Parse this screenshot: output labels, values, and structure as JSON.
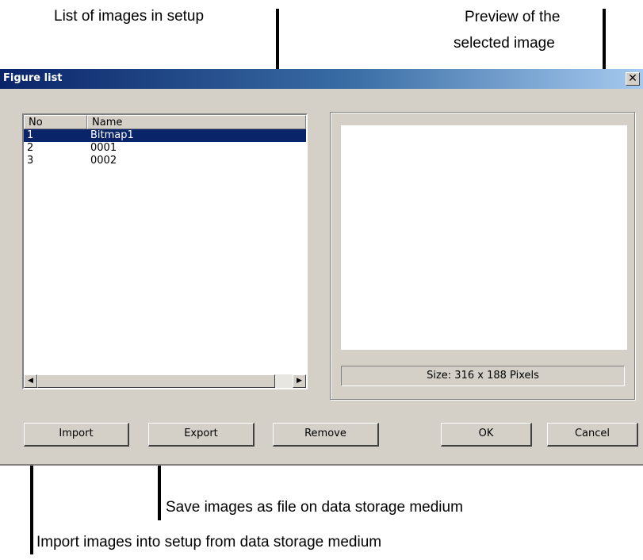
{
  "annotations": {
    "list_label": "List of images in setup",
    "preview_label_line1": "Preview of the",
    "preview_label_line2": "selected image",
    "export_label": "Save images as file on data storage medium",
    "import_label": "Import images into setup from data storage medium"
  },
  "dialog": {
    "title": "Figure list",
    "close_symbol": "✕",
    "list": {
      "columns": [
        "No",
        "Name"
      ],
      "rows": [
        {
          "no": "1",
          "name": "Bitmap1",
          "selected": true
        },
        {
          "no": "2",
          "name": "0001",
          "selected": false
        },
        {
          "no": "3",
          "name": "0002",
          "selected": false
        }
      ],
      "scroll_left_icon": "◀",
      "scroll_right_icon": "▶"
    },
    "preview": {
      "size_text": "Size: 316 x 188 Pixels"
    },
    "buttons": {
      "import": "Import",
      "export": "Export",
      "remove": "Remove",
      "ok": "OK",
      "cancel": "Cancel"
    }
  }
}
